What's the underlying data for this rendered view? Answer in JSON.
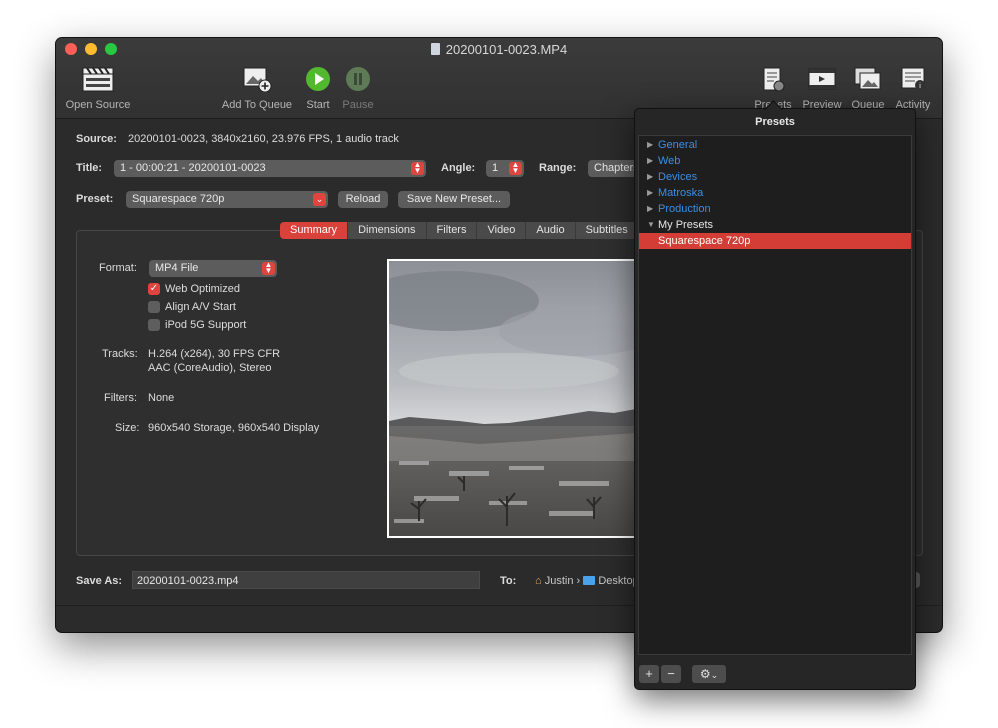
{
  "window": {
    "title": "20200101-0023.MP4"
  },
  "toolbar": {
    "open_source": "Open Source",
    "add_to_queue": "Add To Queue",
    "start": "Start",
    "pause": "Pause",
    "presets": "Presets",
    "preview": "Preview",
    "queue": "Queue",
    "activity": "Activity"
  },
  "source": {
    "label": "Source:",
    "value": "20200101-0023, 3840x2160, 23.976 FPS, 1 audio track"
  },
  "title_row": {
    "label": "Title:",
    "value": "1 - 00:00:21 - 20200101-0023",
    "angle_label": "Angle:",
    "angle_value": "1",
    "range_label": "Range:",
    "range_value": "Chapters"
  },
  "preset_row": {
    "label": "Preset:",
    "value": "Squarespace 720p",
    "reload": "Reload",
    "save_new": "Save New Preset..."
  },
  "tabs": [
    "Summary",
    "Dimensions",
    "Filters",
    "Video",
    "Audio",
    "Subtitles"
  ],
  "summary": {
    "format_label": "Format:",
    "format_value": "MP4 File",
    "web_optimized": "Web Optimized",
    "align_av": "Align A/V Start",
    "ipod": "iPod 5G Support",
    "tracks_label": "Tracks:",
    "tracks_line1": "H.264 (x264), 30 FPS CFR",
    "tracks_line2": "AAC (CoreAudio), Stereo",
    "filters_label": "Filters:",
    "filters_value": "None",
    "size_label": "Size:",
    "size_value": "960x540 Storage, 960x540 Display"
  },
  "save": {
    "label": "Save As:",
    "value": "20200101-0023.mp4",
    "to_label": "To:",
    "path_user": "Justin",
    "path_folder": "Desktop"
  },
  "presets_panel": {
    "title": "Presets",
    "categories": [
      "General",
      "Web",
      "Devices",
      "Matroska",
      "Production",
      "My Presets"
    ],
    "selected": "Squarespace 720p",
    "add": "+",
    "remove": "−"
  },
  "colors": {
    "accent": "#e0443e",
    "link": "#3b8fe5",
    "window_bg": "#2b2b2b"
  }
}
